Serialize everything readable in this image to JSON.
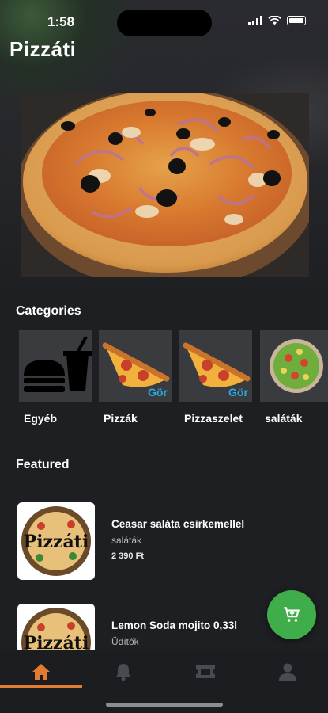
{
  "status": {
    "time": "1:58"
  },
  "header": {
    "title": "Pizzáti"
  },
  "sections": {
    "categories": "Categories",
    "featured": "Featured"
  },
  "categories": [
    {
      "label": "Egyéb",
      "icon": "burger-drink-icon"
    },
    {
      "label": "Pizzák",
      "icon": "pizza-slice-icon"
    },
    {
      "label": "Pizzaszelet",
      "icon": "pizza-slice-icon"
    },
    {
      "label": "saláták",
      "icon": "salad-bowl-icon"
    }
  ],
  "featured": [
    {
      "name": "Ceasar saláta csirkemellel",
      "category": "saláták",
      "price": "2 390 Ft",
      "logo_text": "Pizzáti"
    },
    {
      "name": "Lemon Soda mojito 0,33l",
      "category": "Üdítők",
      "price": "",
      "logo_text": "Pizzáti"
    }
  ],
  "tabs": [
    {
      "name": "home",
      "icon": "home-icon",
      "active": true
    },
    {
      "name": "notifications",
      "icon": "bell-icon",
      "active": false
    },
    {
      "name": "coupons",
      "icon": "ticket-icon",
      "active": false
    },
    {
      "name": "profile",
      "icon": "user-icon",
      "active": false
    }
  ],
  "colors": {
    "accent": "#e07b2f",
    "fab": "#3fae4a",
    "background": "#1e1f23"
  }
}
